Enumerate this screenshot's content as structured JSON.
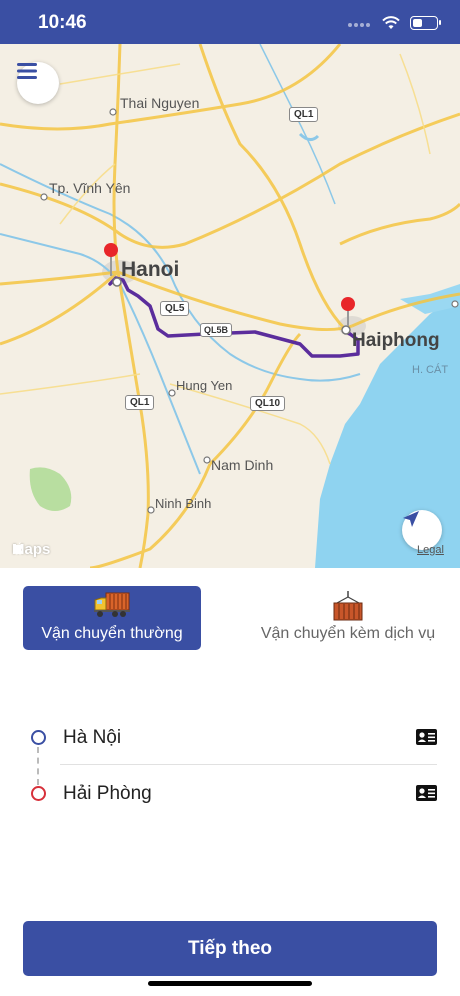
{
  "status_bar": {
    "time": "10:46",
    "battery_level": 0.4
  },
  "map": {
    "cities": [
      "Thai Nguyen",
      "Tp. Vĩnh Yên",
      "Hanoi",
      "Haiphong",
      "Hung Yen",
      "Nam Dinh",
      "Ninh Binh",
      "H. CÁT"
    ],
    "road_badges": [
      "QL1",
      "QL5",
      "QL5B",
      "QL1",
      "QL10"
    ],
    "brand": "Maps",
    "legal": "Legal",
    "route_color": "#5b2d9c",
    "pin_color": "#e8262a"
  },
  "service_tabs": [
    {
      "label": "Vận chuyển thường",
      "icon": "truck-icon",
      "selected": true
    },
    {
      "label": "Vận chuyển kèm dịch vụ",
      "icon": "container-crane-icon",
      "selected": false
    }
  ],
  "route": {
    "origin": "Hà Nội",
    "destination": "Hải Phòng"
  },
  "actions": {
    "next_label": "Tiếp theo"
  },
  "colors": {
    "primary": "#3a4fa3",
    "origin_dot": "#3a4fa3",
    "destination_dot": "#d7303a"
  }
}
